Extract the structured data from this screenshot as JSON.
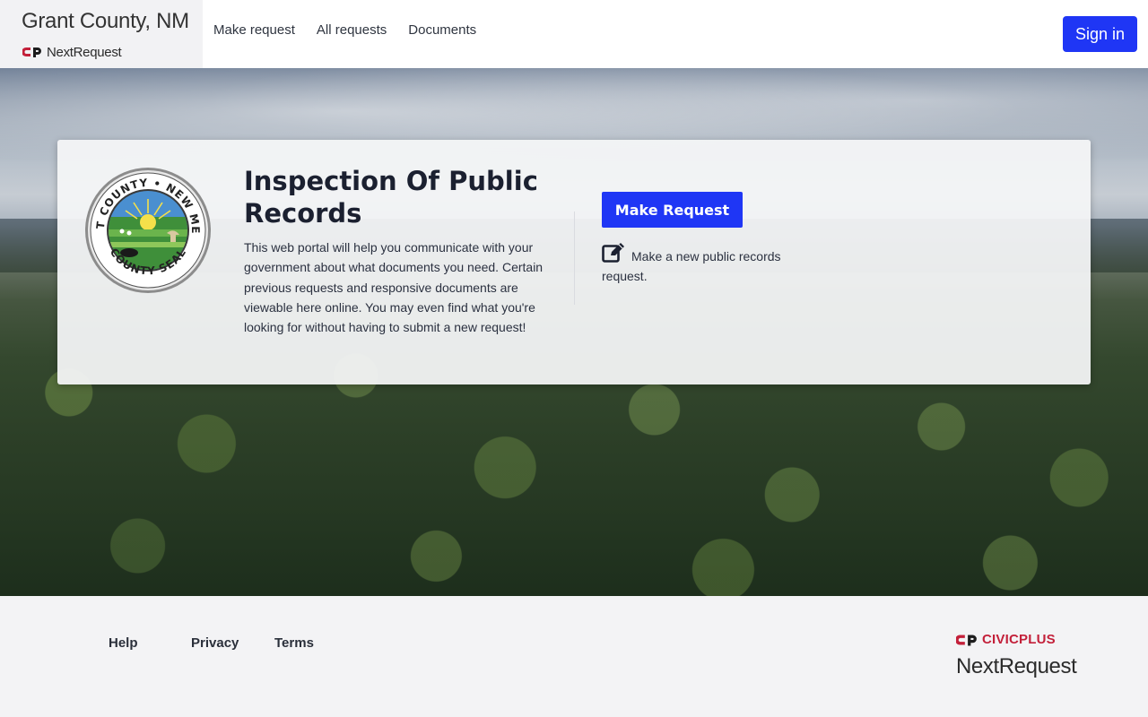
{
  "header": {
    "org_name": "Grant County, NM",
    "brand": "NextRequest",
    "nav": [
      "Make request",
      "All requests",
      "Documents"
    ],
    "sign_in": "Sign in"
  },
  "card": {
    "title": "Inspection Of Public Records",
    "description": "This web portal will help you communicate with your government about what documents you need. Certain previous requests and responsive documents are viewable here online. You may even find what you're looking for without having to submit a new request!",
    "button": "Make Request",
    "button_desc": "Make a new public records request.",
    "seal_text": "GRANT COUNTY • NEW MEXICO • COUNTY SEAL"
  },
  "footer": {
    "links": [
      "Help",
      "Privacy",
      "Terms"
    ],
    "civic_brand": "CIVICPLUS",
    "product": "NextRequest"
  },
  "colors": {
    "accent": "#1f36f5",
    "civic_red": "#c3203a"
  }
}
